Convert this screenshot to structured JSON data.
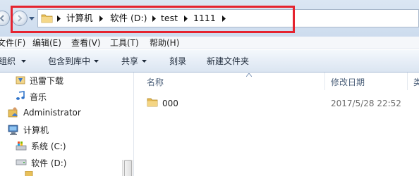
{
  "address": {
    "breadcrumbs": [
      "计算机",
      "软件 (D:)",
      "test",
      "1111"
    ]
  },
  "menu": {
    "items": [
      "文件(F)",
      "编辑(E)",
      "查看(V)",
      "工具(T)",
      "帮助(H)"
    ]
  },
  "toolbar": {
    "organize": "组织",
    "include_in_library": "包含到库中",
    "share": "共享",
    "burn": "刻录",
    "new_folder": "新建文件夹"
  },
  "nav": {
    "items": [
      {
        "label": "迅雷下载",
        "icon": "thunder-download-icon"
      },
      {
        "label": "音乐",
        "icon": "music-icon"
      },
      {
        "label": "Administrator",
        "icon": "user-folder-icon"
      },
      {
        "label": "计算机",
        "icon": "computer-icon"
      },
      {
        "label": "系统 (C:)",
        "icon": "system-drive-icon"
      },
      {
        "label": "软件 (D:)",
        "icon": "drive-icon"
      }
    ]
  },
  "columns": {
    "name": "名称",
    "modified": "修改日期",
    "type_partial": "类"
  },
  "files": [
    {
      "name": "000",
      "modified": "2017/5/28 22:52",
      "icon": "folder-icon"
    }
  ],
  "colors": {
    "highlight": "#e5232f",
    "column_header_text": "#4c607a",
    "date_text": "#6d6d6d"
  }
}
